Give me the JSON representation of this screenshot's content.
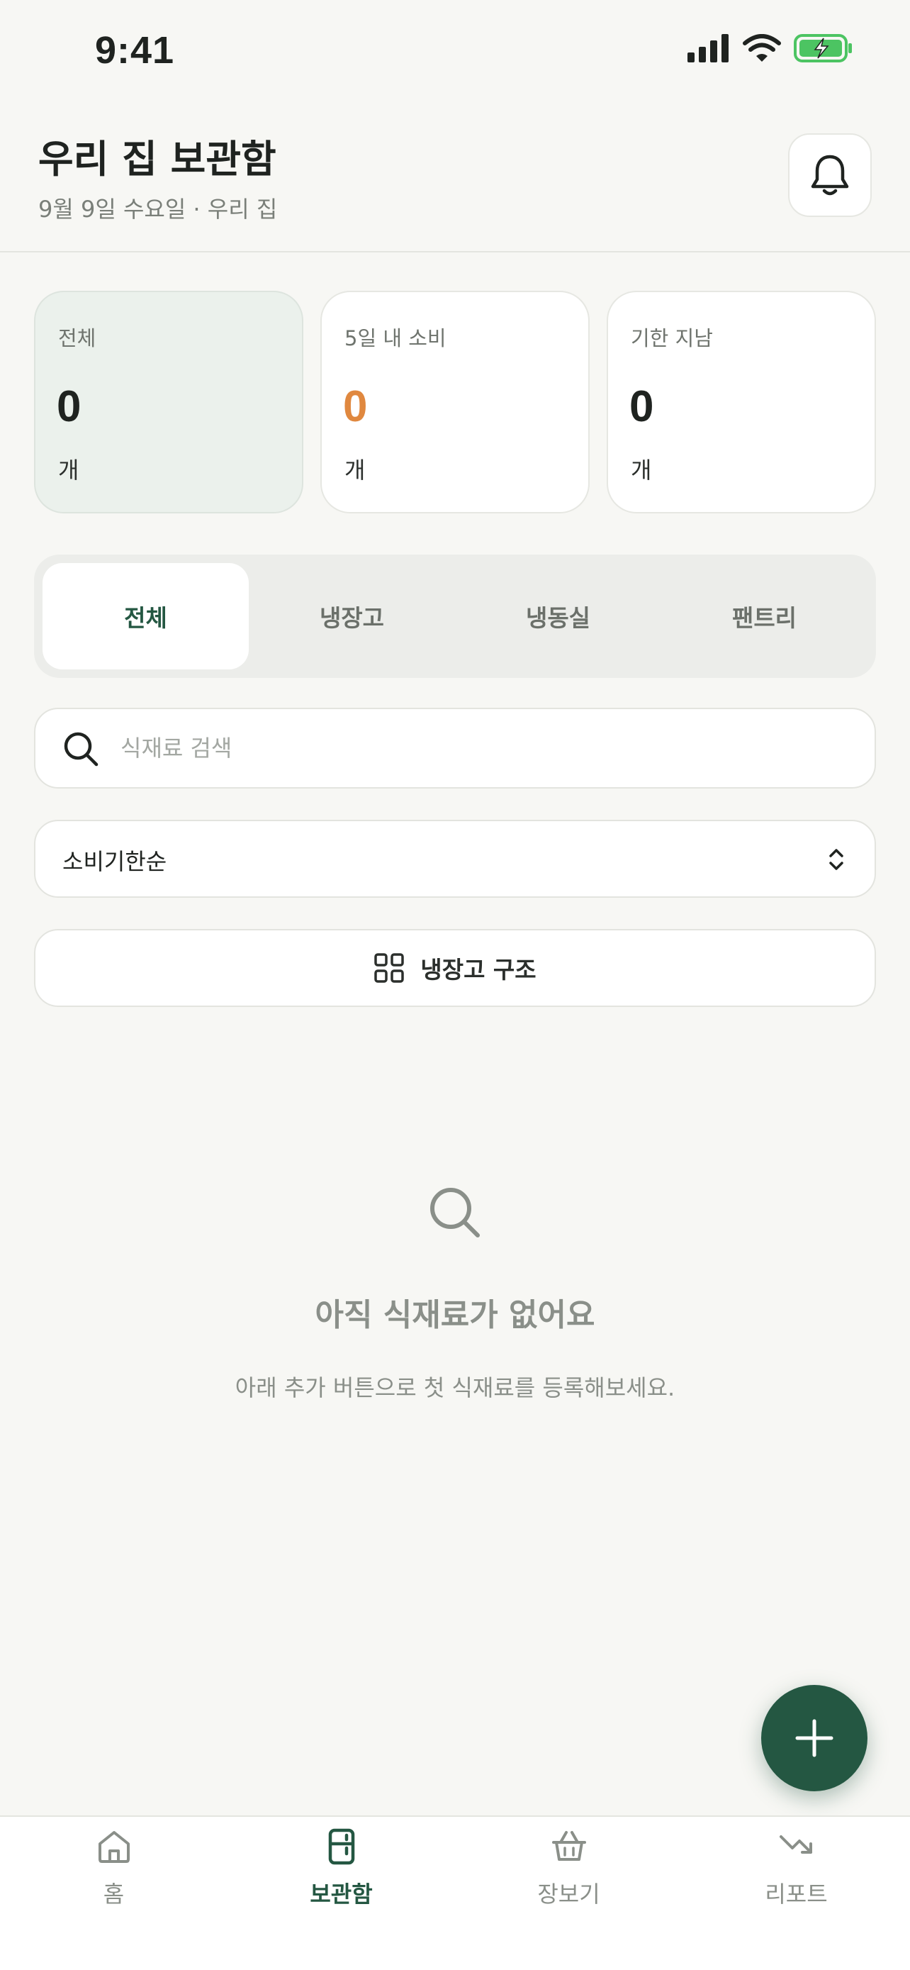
{
  "status_bar": {
    "time": "9:41"
  },
  "header": {
    "title": "우리 집 보관함",
    "subtitle": "9월 9일 수요일 · 우리 집"
  },
  "stats": [
    {
      "label": "전체",
      "value": "0",
      "unit": "개"
    },
    {
      "label": "5일 내 소비",
      "value": "0",
      "unit": "개"
    },
    {
      "label": "기한 지남",
      "value": "0",
      "unit": "개"
    }
  ],
  "tabs": [
    {
      "label": "전체",
      "active": true
    },
    {
      "label": "냉장고",
      "active": false
    },
    {
      "label": "냉동실",
      "active": false
    },
    {
      "label": "팬트리",
      "active": false
    }
  ],
  "search": {
    "placeholder": "식재료 검색",
    "value": ""
  },
  "sort": {
    "selected": "소비기한순"
  },
  "fridge_button": {
    "label": "냉장고 구조"
  },
  "empty_state": {
    "title": "아직 식재료가 없어요",
    "description": "아래 추가 버튼으로 첫 식재료를 등록해보세요."
  },
  "bottom_nav": [
    {
      "label": "홈",
      "icon": "home-icon",
      "active": false
    },
    {
      "label": "보관함",
      "icon": "fridge-icon",
      "active": true
    },
    {
      "label": "장보기",
      "icon": "basket-icon",
      "active": false
    },
    {
      "label": "리포트",
      "icon": "trend-icon",
      "active": false
    }
  ],
  "colors": {
    "accent": "#245742",
    "warning": "#e0883f",
    "background": "#f7f7f4",
    "battery": "#4cc462"
  }
}
